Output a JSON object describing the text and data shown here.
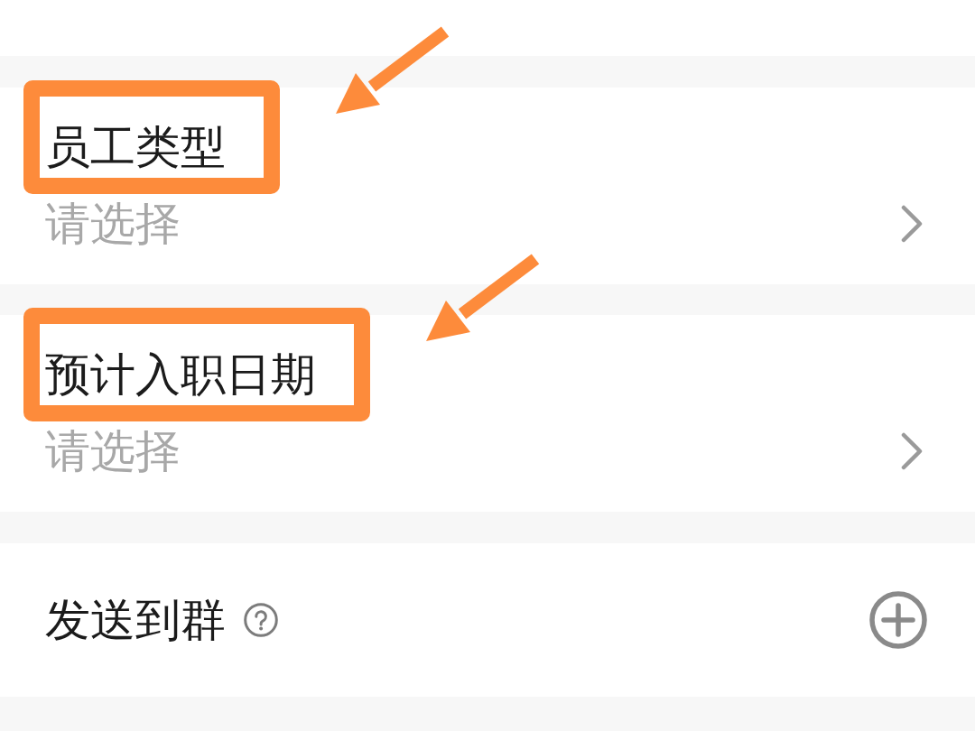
{
  "fields": [
    {
      "kind": "select",
      "label": "员工类型",
      "placeholder": "请选择",
      "highlighted": true
    },
    {
      "kind": "select",
      "label": "预计入职日期",
      "placeholder": "请选择",
      "highlighted": true
    },
    {
      "kind": "add",
      "label": "发送到群",
      "help": true,
      "highlighted": false
    }
  ]
}
